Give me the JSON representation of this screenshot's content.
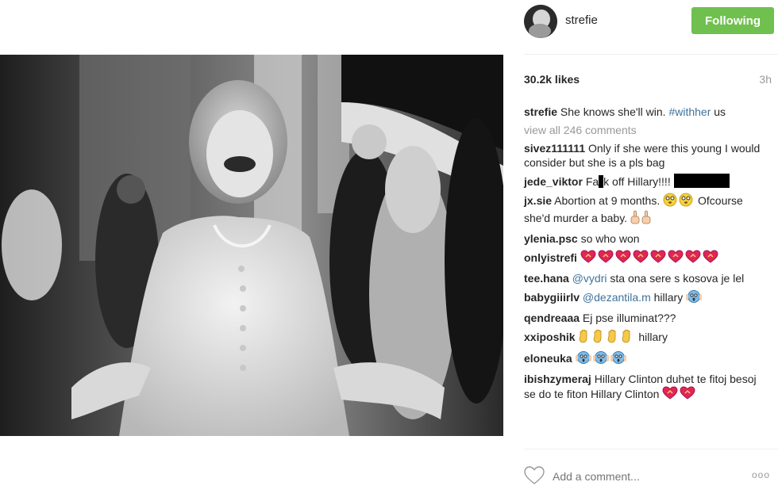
{
  "post": {
    "username": "strefie",
    "follow_label": "Following",
    "likes": "30.2k likes",
    "time": "3h",
    "caption_user": "strefie",
    "caption_text": " She knows she'll win. ",
    "caption_tag": "#withher",
    "caption_tail": " us",
    "view_all": "view all 246 comments",
    "add_comment_placeholder": "Add a comment...",
    "more_label": "ooo"
  },
  "comments": [
    {
      "user": "sivez111111",
      "text": " Only if she were this young I would consider but she is a pls bag"
    },
    {
      "user": "jede_viktor",
      "text_a": " Fa",
      "text_b": "k off Hillary!!!! "
    },
    {
      "user": "jx.sie",
      "text_a": " Abortion at 9 months. ",
      "text_b": " Ofcourse she'd murder a baby. "
    },
    {
      "user": "ylenia.psc",
      "text": " so who won"
    },
    {
      "user": "onlyistrefi",
      "text": " "
    },
    {
      "user": "tee.hana",
      "mention": "@vydri",
      "text": " sta ona sere s kosova je lel"
    },
    {
      "user": "babygiiirlv",
      "mention": "@dezantila.m",
      "text": " hillary "
    },
    {
      "user": "qendreaaa",
      "text": " Ej pse illuminat???"
    },
    {
      "user": "xxiposhik",
      "text": " hillary"
    },
    {
      "user": "eloneuka",
      "text": " "
    },
    {
      "user": "ibishzymeraj",
      "text": " Hillary Clinton duhet te fitoj besoj se do te fiton Hillary Clinton "
    }
  ],
  "colors": {
    "follow_green": "#70c050",
    "link_blue": "#3f729b",
    "muted_gray": "#999999"
  },
  "icons": [
    "heart-outline-icon",
    "avatar",
    "emoji-flushed-face-icon",
    "emoji-middle-finger-icon",
    "emoji-heart-icon",
    "emoji-scream-face-icon",
    "emoji-hand-icon"
  ]
}
